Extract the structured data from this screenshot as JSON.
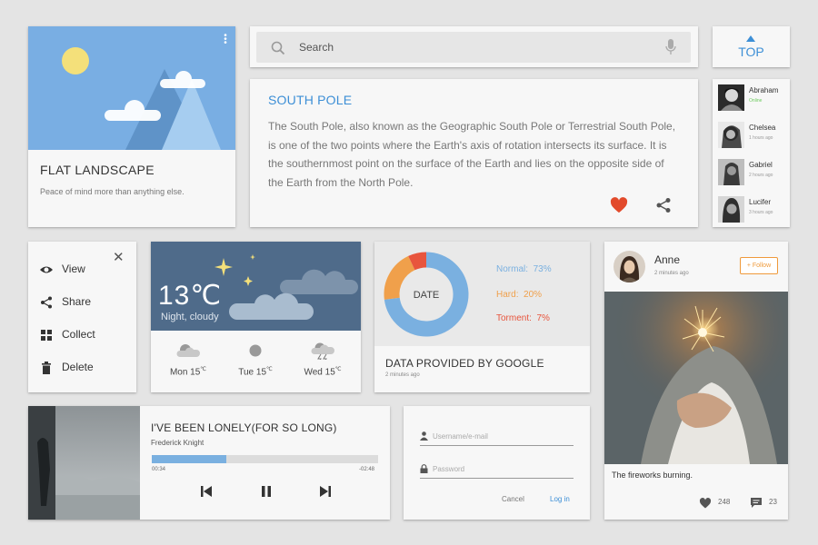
{
  "landscape_card": {
    "title": "FLAT LANDSCAPE",
    "subtitle": "Peace of mind more than anything else.",
    "menu_icon": "more-vert-icon",
    "colors": {
      "sky": "#79aee3",
      "sun": "#f4e07a",
      "mountain": "#5f93c8",
      "mountain_light": "#a6cdf0"
    }
  },
  "search": {
    "placeholder": "Search",
    "icon": "search-icon",
    "mic_icon": "mic-icon"
  },
  "top_button": {
    "label": "TOP",
    "icon": "arrow-up-icon"
  },
  "article": {
    "title": "SOUTH POLE",
    "body": "The South Pole, also known as the Geographic South Pole or Terrestrial South Pole, is one of the two points where the Earth's axis of rotation intersects its surface. It is the southernmost point on the surface of the Earth and lies on the opposite side of the Earth from the North Pole.",
    "like_icon": "heart-icon",
    "share_icon": "share-icon"
  },
  "contacts": [
    {
      "name": "Abraham",
      "status": "Online",
      "online": true
    },
    {
      "name": "Chelsea",
      "status": "1 hours ago",
      "online": false
    },
    {
      "name": "Gabriel",
      "status": "2 hours ago",
      "online": false
    },
    {
      "name": "Lucifer",
      "status": "3 hours ago",
      "online": false
    }
  ],
  "menu": {
    "close_icon": "close-icon",
    "items": [
      {
        "label": "View",
        "icon": "eye-icon"
      },
      {
        "label": "Share",
        "icon": "share-icon"
      },
      {
        "label": "Collect",
        "icon": "grid-icon"
      },
      {
        "label": "Delete",
        "icon": "trash-icon"
      }
    ]
  },
  "weather": {
    "temperature": "13℃",
    "condition": "Night, cloudy",
    "forecast": [
      {
        "day": "Mon",
        "temp": "15",
        "unit": "℃",
        "icon": "partly-cloudy-icon"
      },
      {
        "day": "Tue",
        "temp": "15",
        "unit": "℃",
        "icon": "sun-icon"
      },
      {
        "day": "Wed",
        "temp": "15",
        "unit": "℃",
        "icon": "thunderstorm-icon"
      }
    ],
    "colors": {
      "panel": "#4f6b8a",
      "star": "#f4e07a"
    }
  },
  "chart_data": {
    "type": "pie",
    "center_label": "DATE",
    "categories": [
      "Normal",
      "Hard",
      "Torment"
    ],
    "values": [
      73,
      20,
      7
    ],
    "legend": [
      {
        "label": "Normal",
        "value": "73%",
        "color": "#7ab0e0"
      },
      {
        "label": "Hard",
        "value": "20%",
        "color": "#f0a04b"
      },
      {
        "label": "Torment",
        "value": "7%",
        "color": "#e8553d"
      }
    ],
    "title": "DATA PROVIDED BY GOOGLE",
    "time": "2 minutes ago"
  },
  "social": {
    "name": "Anne",
    "time": "2 minutes ago",
    "follow_label": "+ Follow",
    "caption": "The fireworks burning.",
    "likes": "248",
    "comments": "23",
    "like_icon": "heart-icon",
    "comment_icon": "comment-icon"
  },
  "player": {
    "song": "I'VE BEEN LONELY(FOR SO LONG)",
    "artist": "Frederick Knight",
    "elapsed": "00:34",
    "remaining": "-02:48",
    "progress": 0.33,
    "controls": [
      "previous-icon",
      "pause-icon",
      "next-icon"
    ]
  },
  "login": {
    "username_placeholder": "Username/e-mail",
    "password_placeholder": "Password",
    "cancel_label": "Cancel",
    "login_label": "Log in"
  }
}
